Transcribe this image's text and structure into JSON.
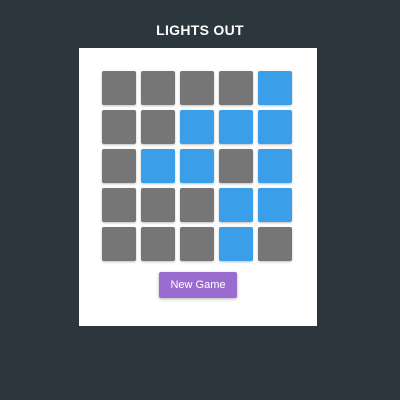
{
  "title": "LIGHTS OUT",
  "new_game_label": "New Game",
  "colors": {
    "background": "#2c363d",
    "panel": "#ffffff",
    "light_on": "#3a9ee8",
    "light_off": "#767676",
    "button": "#9b6ccf"
  },
  "grid": {
    "rows": 5,
    "cols": 5,
    "state": [
      [
        0,
        0,
        0,
        0,
        1
      ],
      [
        0,
        0,
        1,
        1,
        1
      ],
      [
        0,
        1,
        1,
        0,
        1
      ],
      [
        0,
        0,
        0,
        1,
        1
      ],
      [
        0,
        0,
        0,
        1,
        0
      ]
    ]
  }
}
